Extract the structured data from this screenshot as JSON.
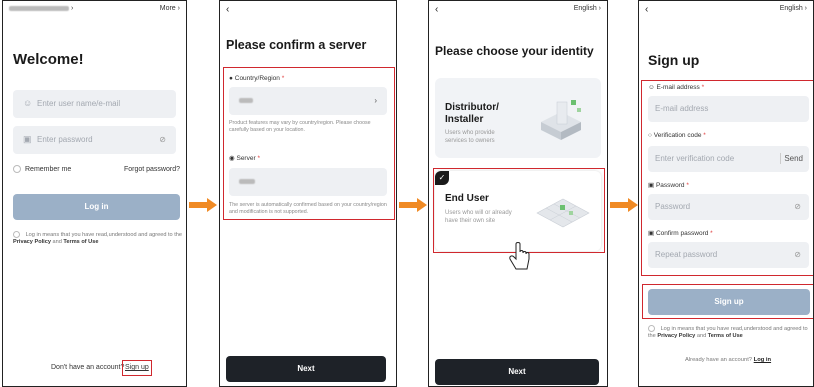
{
  "screen1": {
    "title": "Welcome!",
    "more": "More",
    "username_placeholder": "Enter user name/e-mail",
    "password_placeholder": "Enter password",
    "remember_me": "Remember me",
    "forgot_password": "Forgot password?",
    "login_button": "Log in",
    "terms_prefix": "Log in means that you have read,understood and agreed to the",
    "privacy_policy": "Privacy Policy",
    "and": "and",
    "terms_of_use": "Terms of Use",
    "no_account": "Don't have an account?",
    "sign_up_link": "Sign up"
  },
  "screen2": {
    "title": "Please confirm a server",
    "country_label": "Country/Region",
    "country_note": "Product features may vary by country/region. Please choose carefully based on your location.",
    "server_label": "Server",
    "server_note": "The server is automatically confirmed based on your country/region and modification is not supported.",
    "next_button": "Next"
  },
  "screen3": {
    "language": "English",
    "title": "Please choose your identity",
    "distributor_title": "Distributor/ Installer",
    "distributor_desc": "Users who provide services to owners",
    "enduser_title": "End User",
    "enduser_desc": "Users who will or already have their own site",
    "next_button": "Next"
  },
  "screen4": {
    "language": "English",
    "title": "Sign up",
    "email_label": "E-mail address",
    "email_placeholder": "E-mail address",
    "code_label": "Verification code",
    "code_placeholder": "Enter verification code",
    "send": "Send",
    "password_label": "Password",
    "password_placeholder": "Password",
    "confirm_label": "Confirm password",
    "confirm_placeholder": "Repeat password",
    "signup_button": "Sign up",
    "terms_prefix": "Log in means that you have read,understood and agreed to the",
    "privacy_policy": "Privacy Policy",
    "and": "and",
    "terms_of_use": "Terms of Use",
    "already_account": "Already have an account?",
    "login_link": "Log in"
  },
  "colors": {
    "accent_red": "#d0282e",
    "arrow_orange": "#f08a24",
    "button_disabled": "#9bb0c7",
    "button_dark": "#1e2228",
    "required_star": "#e03a3a"
  }
}
